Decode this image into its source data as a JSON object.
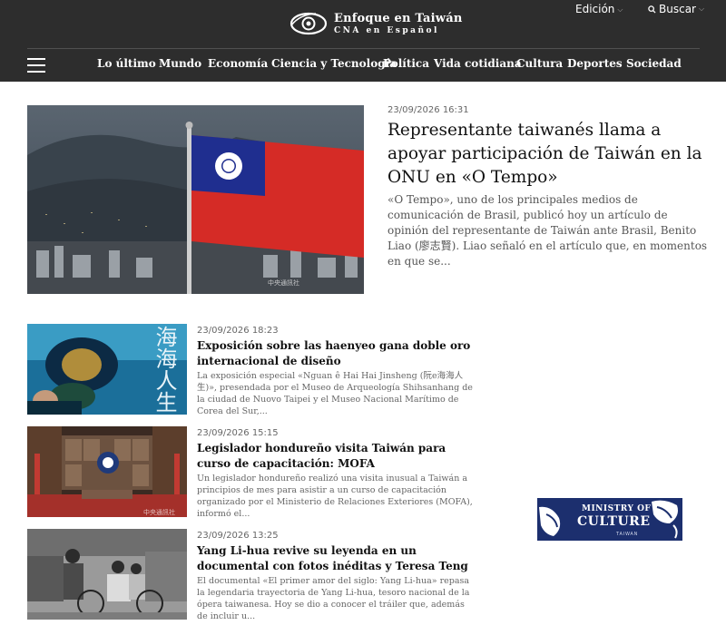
{
  "header": {
    "logo_title": "Enfoque en Taiwán",
    "logo_subtitle": "CNA en Español",
    "edition_label": "Edición",
    "search_label": "Buscar"
  },
  "nav": {
    "items": [
      "Lo último",
      "Mundo",
      "Economía",
      "Ciencia y Tecnología",
      "Política",
      "Vida cotidiana",
      "Cultura",
      "Deportes",
      "Sociedad"
    ]
  },
  "hero": {
    "date": "23/09/2026 16:31",
    "title": "Representante taiwanés llama a apoyar participación de Taiwán en la ONU en «O Tempo»",
    "summary": "«O Tempo», uno de los principales medios de comunicación de Brasil, publicó hoy un artículo de opinión del representante de Taiwán ante Brasil, Benito Liao (廖志賢). Liao señaló en el artículo que, en momentos en que se...",
    "watermark": "中央通訊社"
  },
  "articles": [
    {
      "date": "23/09/2026 18:23",
      "title": "Exposición sobre las haenyeo gana doble oro internacional de diseño",
      "summary": "La exposición especial «Nguan ê Hai Hai Jinsheng (阮e海海人生)», presendada por el Museo de Arqueología Shihsanhang de la ciudad de Nuovo Taipei y el Museo Nacional Marítimo de Corea del Sur,...",
      "image_text": "海海人生"
    },
    {
      "date": "23/09/2026 15:15",
      "title": "Legislador hondureño visita Taiwán para curso de capacitación: MOFA",
      "summary": "Un legislador hondureño realizó una visita inusual a Taiwán a principios de mes para asistir a un curso de capacitación organizado por el Ministerio de Relaciones Exteriores (MOFA), informó el...",
      "watermark": "中央通訊社"
    },
    {
      "date": "23/09/2026 13:25",
      "title": "Yang Li-hua revive su leyenda en un documental con fotos inéditas y Teresa Teng",
      "summary": "El documental «El primer amor del siglo: Yang Li-hua» repasa la legendaria trayectoria de Yang Li-hua, tesoro nacional de la ópera taiwanesa. Hoy se dio a conocer el tráiler que, además de incluir u..."
    }
  ],
  "ad": {
    "line1": "MINISTRY OF",
    "line2": "CULTURE",
    "line3": "TAIWAN"
  },
  "colors": {
    "header_bg": "#2d2d2d",
    "ad_bg": "#1c2f6e",
    "flag_red": "#d52b26",
    "flag_blue": "#1f2e8f"
  }
}
